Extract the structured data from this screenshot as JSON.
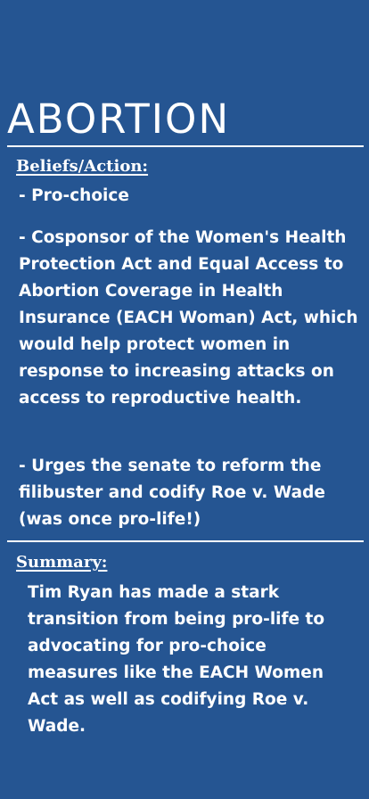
{
  "title": "ABORTION",
  "beliefs": {
    "heading": "Beliefs/Action:",
    "items": [
      "- Pro-choice",
      "- Cosponsor of the Women's Health Protection Act and Equal Access to Abortion Coverage in Health Insurance (EACH Woman) Act, which would help protect women in response to increasing attacks on access to reproductive health.",
      "- Urges the senate to reform the filibuster and codify Roe v. Wade (was once pro-life!)"
    ]
  },
  "summary": {
    "heading": "Summary:",
    "text": "Tim Ryan has made a stark transition from being pro-life to advocating for pro-choice measures like the EACH Women Act as well as codifying Roe v. Wade."
  },
  "colors": {
    "background": "#255592",
    "text": "#ffffff"
  }
}
